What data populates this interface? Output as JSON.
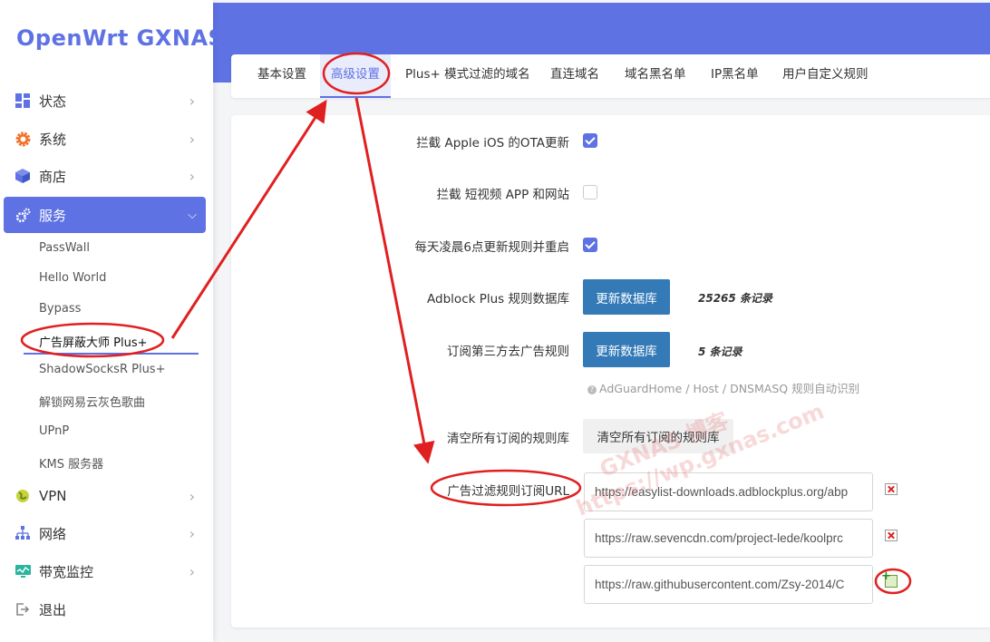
{
  "brand": {
    "logo": "OpenWrt GXNAS"
  },
  "sidebar": {
    "items": [
      {
        "label": "状态",
        "icon": "dashboard-icon"
      },
      {
        "label": "系统",
        "icon": "gear-icon"
      },
      {
        "label": "商店",
        "icon": "cube-icon"
      },
      {
        "label": "服务",
        "icon": "services-gear-icon"
      },
      {
        "label": "VPN",
        "icon": "globe-icon"
      },
      {
        "label": "网络",
        "icon": "network-icon"
      },
      {
        "label": "带宽监控",
        "icon": "monitor-icon"
      },
      {
        "label": "退出",
        "icon": "logout-icon"
      }
    ],
    "sub_items": [
      "PassWall",
      "Hello World",
      "Bypass",
      "广告屏蔽大师 Plus+",
      "ShadowSocksR Plus+",
      "解锁网易云灰色歌曲",
      "UPnP",
      "KMS 服务器"
    ]
  },
  "tabs": [
    "基本设置",
    "高级设置",
    "Plus+ 模式过滤的域名",
    "直连域名",
    "域名黑名单",
    "IP黑名单",
    "用户自定义规则"
  ],
  "form": {
    "ota_label": "拦截 Apple iOS 的OTA更新",
    "ota_checked": true,
    "video_label": "拦截 短视频 APP 和网站",
    "video_checked": false,
    "daily_label": "每天凌晨6点更新规则并重启",
    "daily_checked": true,
    "abp_label": "Adblock Plus 规则数据库",
    "abp_button": "更新数据库",
    "abp_count": "25265 条记录",
    "third_label": "订阅第三方去广告规则",
    "third_button": "更新数据库",
    "third_count": "5 条记录",
    "hint": "AdGuardHome / Host / DNSMASQ 规则自动识别",
    "clear_label": "清空所有订阅的规则库",
    "clear_button": "清空所有订阅的规则库",
    "url_label": "广告过滤规则订阅URL",
    "urls": [
      "https://easylist-downloads.adblockplus.org/abp",
      "https://raw.sevencdn.com/project-lede/koolprc",
      "https://raw.githubusercontent.com/Zsy-2014/C"
    ]
  },
  "watermark": {
    "line1": "GXNAS 博客",
    "line2": "https://wp.gxnas.com"
  },
  "colors": {
    "accent": "#5e72e4",
    "primary_button": "#337ab7",
    "annotation": "#e02020"
  }
}
